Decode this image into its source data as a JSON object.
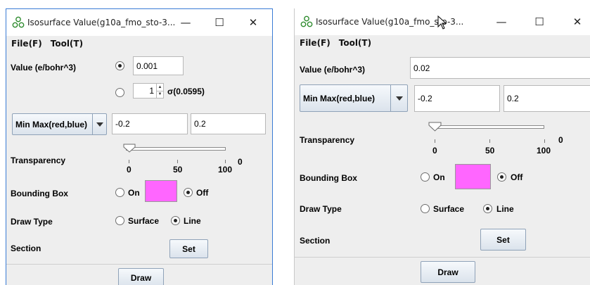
{
  "window1": {
    "title": "Isosurface Value(g10a_fmo_sto-3...",
    "menu": {
      "file": "File(F)",
      "tool": "Tool(T)"
    },
    "value_label": "Value (e/bohr^3)",
    "value_input": "0.001",
    "sigma_spinner_value": "1",
    "sigma_label": "σ(0.0595)",
    "minmax_combo": "Min Max(red,blue)",
    "min_value": "-0.2",
    "max_value": "0.2",
    "transparency_label": "Transparency",
    "transparency_ticks": [
      "0",
      "50",
      "100"
    ],
    "transparency_value_label": "0",
    "transparency_level": 0,
    "bounding_box_label": "Bounding Box",
    "on_label": "On",
    "off_label": "Off",
    "draw_type_label": "Draw Type",
    "surface_label": "Surface",
    "line_label": "Line",
    "section_label": "Section",
    "set_button": "Set",
    "draw_button": "Draw"
  },
  "window2": {
    "title": "Isosurface Value(g10a_fmo_sto-3...",
    "menu": {
      "file": "File(F)",
      "tool": "Tool(T)"
    },
    "value_label": "Value (e/bohr^3)",
    "value_input": "0.02",
    "minmax_combo": "Min Max(red,blue)",
    "min_value": "-0.2",
    "max_value": "0.2",
    "transparency_label": "Transparency",
    "transparency_ticks": [
      "0",
      "50",
      "100"
    ],
    "transparency_value_label": "0",
    "transparency_level": 0,
    "bounding_box_label": "Bounding Box",
    "on_label": "On",
    "off_label": "Off",
    "draw_type_label": "Draw Type",
    "surface_label": "Surface",
    "line_label": "Line",
    "section_label": "Section",
    "set_button": "Set",
    "draw_button": "Draw"
  },
  "titlebar_buttons": {
    "minimize": "—",
    "maximize": "☐",
    "close": "✕"
  },
  "colors": {
    "bounding_box_color": "#ff66ff",
    "window_border_active": "#3a7bd5"
  },
  "icons": [
    "app-molecule-icon",
    "dropdown-arrow-icon",
    "mouse-cursor-icon"
  ]
}
